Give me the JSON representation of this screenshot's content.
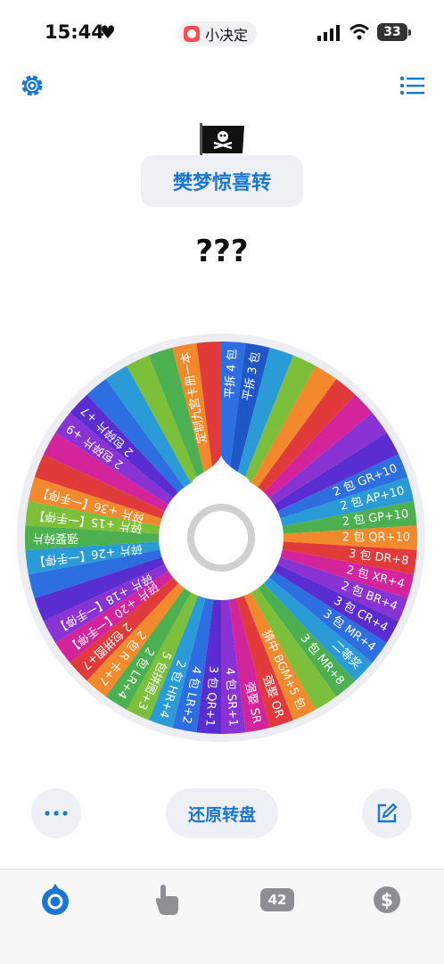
{
  "status": {
    "time": "15:44",
    "app_name": "小决定",
    "battery": "33"
  },
  "header": {
    "title": "樊梦惊喜转",
    "flag_icon": "pirate-flag-icon"
  },
  "result": "???",
  "wheel": {
    "segments": [
      {
        "label": "平拆 4 包",
        "color": "#2d6fe0"
      },
      {
        "label": "平拆 3 包",
        "color": "#1f57c7"
      },
      {
        "label": "",
        "color": "#2b9bd8"
      },
      {
        "label": "",
        "color": "#7bbf3a"
      },
      {
        "label": "",
        "color": "#f2892c"
      },
      {
        "label": "",
        "color": "#e03a3a"
      },
      {
        "label": "",
        "color": "#d3249b"
      },
      {
        "label": "",
        "color": "#8a33d4"
      },
      {
        "label": "",
        "color": "#5a2dd0"
      },
      {
        "label": "2 包 GR+10",
        "color": "#2d6fe0"
      },
      {
        "label": "2 包 AP+10",
        "color": "#2b9bd8"
      },
      {
        "label": "2 包 GP+10",
        "color": "#4caf50"
      },
      {
        "label": "2 包 QR+10",
        "color": "#f2892c"
      },
      {
        "label": "3 包 DR+8",
        "color": "#e03a3a"
      },
      {
        "label": "2 包 XR+4",
        "color": "#d3249b"
      },
      {
        "label": "2 包 BR+4",
        "color": "#8a33d4"
      },
      {
        "label": "3 包 CR+4",
        "color": "#5a2dd0"
      },
      {
        "label": "3 包 MR+4",
        "color": "#2d6fe0"
      },
      {
        "label": "二等奖",
        "color": "#2b9bd8"
      },
      {
        "label": "3 包 MR+8",
        "color": "#4caf50"
      },
      {
        "label": "",
        "color": "#7bbf3a"
      },
      {
        "label": "猜中 BGM+5 包",
        "color": "#f2892c"
      },
      {
        "label": "强娶 OR",
        "color": "#e03a3a"
      },
      {
        "label": "强娶 SR",
        "color": "#d3249b"
      },
      {
        "label": "4 包 SR+1",
        "color": "#8a33d4"
      },
      {
        "label": "3 包 QR+1",
        "color": "#5a2dd0"
      },
      {
        "label": "4 包 LR+2",
        "color": "#2d6fe0"
      },
      {
        "label": "2 包 HR+4",
        "color": "#2b9bd8"
      },
      {
        "label": "5 包拼图+3",
        "color": "#7bbf3a"
      },
      {
        "label": "2 包 LR+4",
        "color": "#4caf50"
      },
      {
        "label": "2 包 R 卡+7",
        "color": "#f2892c"
      },
      {
        "label": "2 包拼图+7",
        "color": "#e03a3a"
      },
      {
        "label": "碎片 +20【一手停】",
        "color": "#d3249b"
      },
      {
        "label": "碎片 +18【一手停】",
        "color": "#8a33d4"
      },
      {
        "label": "",
        "color": "#5a2dd0"
      },
      {
        "label": "",
        "color": "#2d6fe0"
      },
      {
        "label": "碎片 +26【一手停】",
        "color": "#2b9bd8"
      },
      {
        "label": "强娶碎片",
        "color": "#4caf50"
      },
      {
        "label": "碎片 +15【一手停】",
        "color": "#7bbf3a"
      },
      {
        "label": "碎片 +36【一手停】",
        "color": "#f2892c"
      },
      {
        "label": "",
        "color": "#e03a3a"
      },
      {
        "label": "",
        "color": "#d3249b"
      },
      {
        "label": "2 包碎片 +9",
        "color": "#8a33d4"
      },
      {
        "label": "2 包碎片 +7",
        "color": "#5a2dd0"
      },
      {
        "label": "",
        "color": "#2d6fe0"
      },
      {
        "label": "",
        "color": "#2b9bd8"
      },
      {
        "label": "",
        "color": "#7bbf3a"
      },
      {
        "label": "",
        "color": "#4caf50"
      },
      {
        "label": "定制九宫卡册一本",
        "color": "#f2892c"
      },
      {
        "label": "",
        "color": "#e03a3a"
      }
    ]
  },
  "actions": {
    "reset_label": "还原转盘"
  },
  "tabbar": {
    "badge": "42"
  },
  "colors": {
    "accent": "#1976d2",
    "pill_bg": "#eef0f5"
  }
}
